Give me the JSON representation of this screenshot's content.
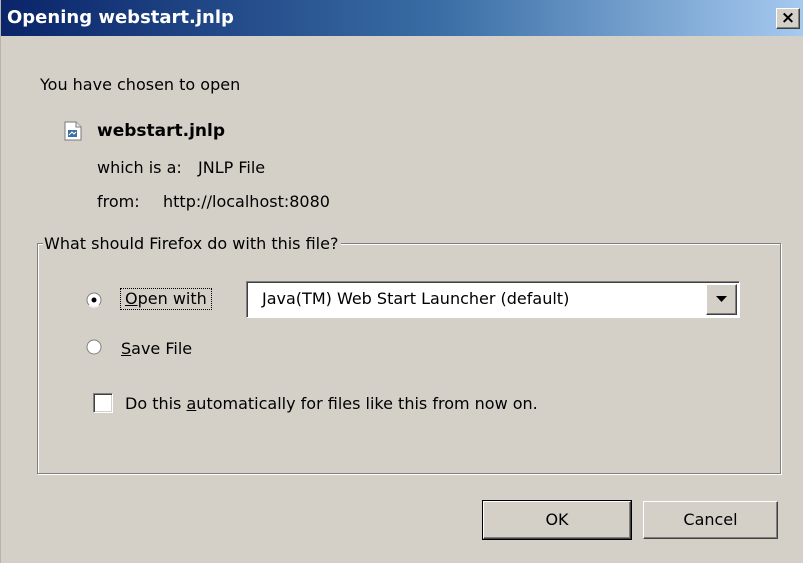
{
  "window": {
    "title": "Opening webstart.jnlp",
    "close_glyph": "×"
  },
  "intro": "You have chosen to open",
  "file": {
    "icon": "jnlp-file-icon",
    "name": "webstart.jnlp",
    "type_label": "which is a:",
    "type_value": "JNLP File",
    "from_label": "from:",
    "from_value": "http://localhost:8080"
  },
  "action_group": {
    "legend": "What should Firefox do with this file?",
    "open_with": {
      "label_mnemonic": "O",
      "label_rest": "pen with",
      "selected": true
    },
    "app_select": {
      "value": "Java(TM) Web Start Launcher (default)"
    },
    "save_file": {
      "label_mnemonic": "S",
      "label_rest": "ave File",
      "selected": false
    },
    "auto_checkbox": {
      "label_before": "Do this ",
      "label_mnemonic": "a",
      "label_after": "utomatically for files like this from now on.",
      "checked": false
    }
  },
  "buttons": {
    "ok": "OK",
    "cancel": "Cancel"
  },
  "colors": {
    "titlebar_start": "#0a246a",
    "titlebar_end": "#a6caf0",
    "dialog_face": "#d4d0c8"
  }
}
